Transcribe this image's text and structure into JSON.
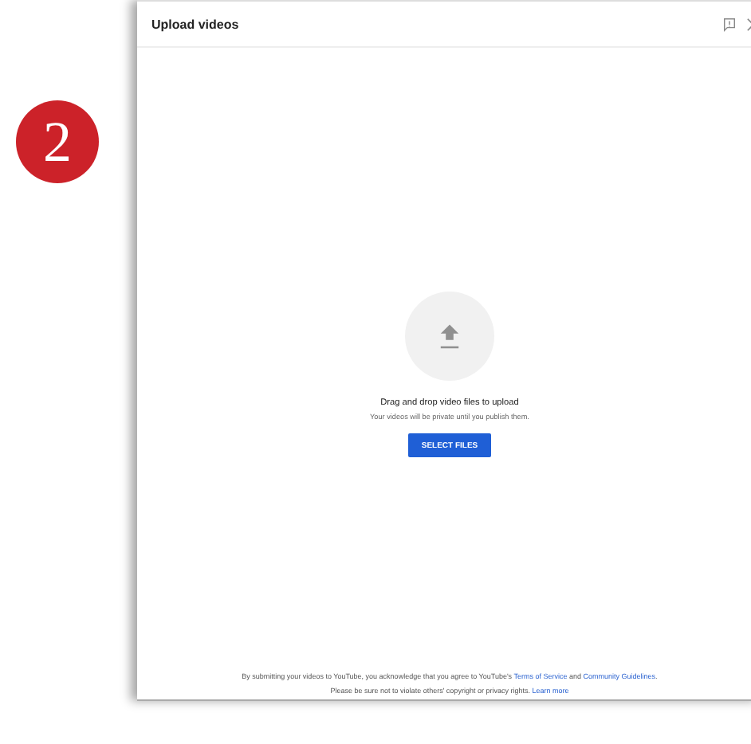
{
  "step_badge": {
    "number": "2"
  },
  "dialog": {
    "title": "Upload videos",
    "drop_zone": {
      "heading": "Drag and drop video files to upload",
      "subtext": "Your videos will be private until you publish them.",
      "button": "SELECT FILES"
    },
    "footer": [
      [
        {
          "kind": "text",
          "text": "By submitting your videos to YouTube, you acknowledge that you agree to YouTube's "
        },
        {
          "kind": "link",
          "text": "Terms of Service"
        },
        {
          "kind": "text",
          "text": " and "
        },
        {
          "kind": "link",
          "text": "Community Guidelines"
        },
        {
          "kind": "text",
          "text": "."
        }
      ],
      [
        {
          "kind": "text",
          "text": "Please be sure not to violate others' copyright or privacy rights. "
        },
        {
          "kind": "link",
          "text": "Learn more"
        }
      ]
    ]
  }
}
